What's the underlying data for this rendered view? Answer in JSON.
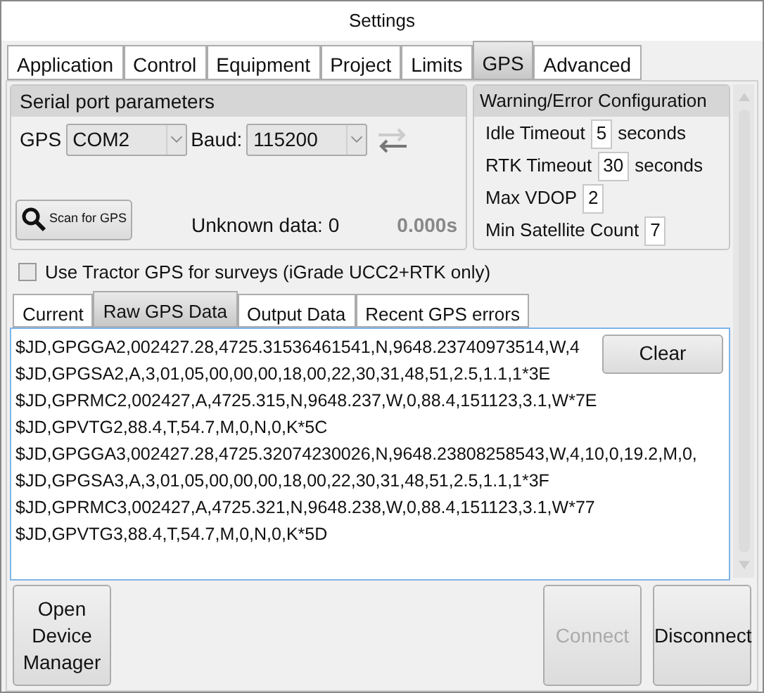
{
  "window": {
    "title": "Settings"
  },
  "tabs": [
    {
      "label": "Application",
      "selected": false
    },
    {
      "label": "Control",
      "selected": false
    },
    {
      "label": "Equipment",
      "selected": false
    },
    {
      "label": "Project",
      "selected": false
    },
    {
      "label": "Limits",
      "selected": false
    },
    {
      "label": "GPS",
      "selected": true
    },
    {
      "label": "Advanced",
      "selected": false
    }
  ],
  "serial_port": {
    "title": "Serial port parameters",
    "gps_label": "GPS",
    "gps_value": "COM2",
    "baud_label": "Baud:",
    "baud_value": "115200",
    "scan_button": "Scan for GPS",
    "unknown_data": "Unknown data: 0",
    "elapsed": "0.000s"
  },
  "warning_config": {
    "title": "Warning/Error Configuration",
    "fields": [
      {
        "label": "Idle Timeout",
        "value": "5",
        "unit": "seconds"
      },
      {
        "label": "RTK Timeout",
        "value": "30",
        "unit": "seconds"
      },
      {
        "label": "Max VDOP",
        "value": "2"
      },
      {
        "label": "Min Satellite Count",
        "value": "7"
      }
    ]
  },
  "tractor_gps": {
    "label": "Use Tractor GPS for surveys (iGrade UCC2+RTK only)",
    "checked": false
  },
  "data_tabs": [
    {
      "label": "Current",
      "selected": false
    },
    {
      "label": "Raw GPS Data",
      "selected": true
    },
    {
      "label": "Output Data",
      "selected": false
    },
    {
      "label": "Recent GPS errors",
      "selected": false
    }
  ],
  "raw_lines": [
    "$JD,GPGGA2,002427.28,4725.31536461541,N,9648.23740973514,W,4",
    "$JD,GPGSA2,A,3,01,05,00,00,00,18,00,22,30,31,48,51,2.5,1.1,1*3E",
    "$JD,GPRMC2,002427,A,4725.315,N,9648.237,W,0,88.4,151123,3.1,W*7E",
    "$JD,GPVTG2,88.4,T,54.7,M,0,N,0,K*5C",
    "$JD,GPGGA3,002427.28,4725.32074230026,N,9648.23808258543,W,4,10,0,19.2,M,0,",
    "$JD,GPGSA3,A,3,01,05,00,00,00,18,00,22,30,31,48,51,2.5,1.1,1*3F",
    "$JD,GPRMC3,002427,A,4725.321,N,9648.238,W,0,88.4,151123,3.1,W*77",
    "$JD,GPVTG3,88.4,T,54.7,M,0,N,0,K*5D"
  ],
  "clear_button": "Clear",
  "buttons": [
    {
      "label": "Open Device Manager",
      "disabled": false
    },
    {
      "label": "Connect",
      "disabled": true
    },
    {
      "label": "Disconnect",
      "disabled": false
    }
  ]
}
